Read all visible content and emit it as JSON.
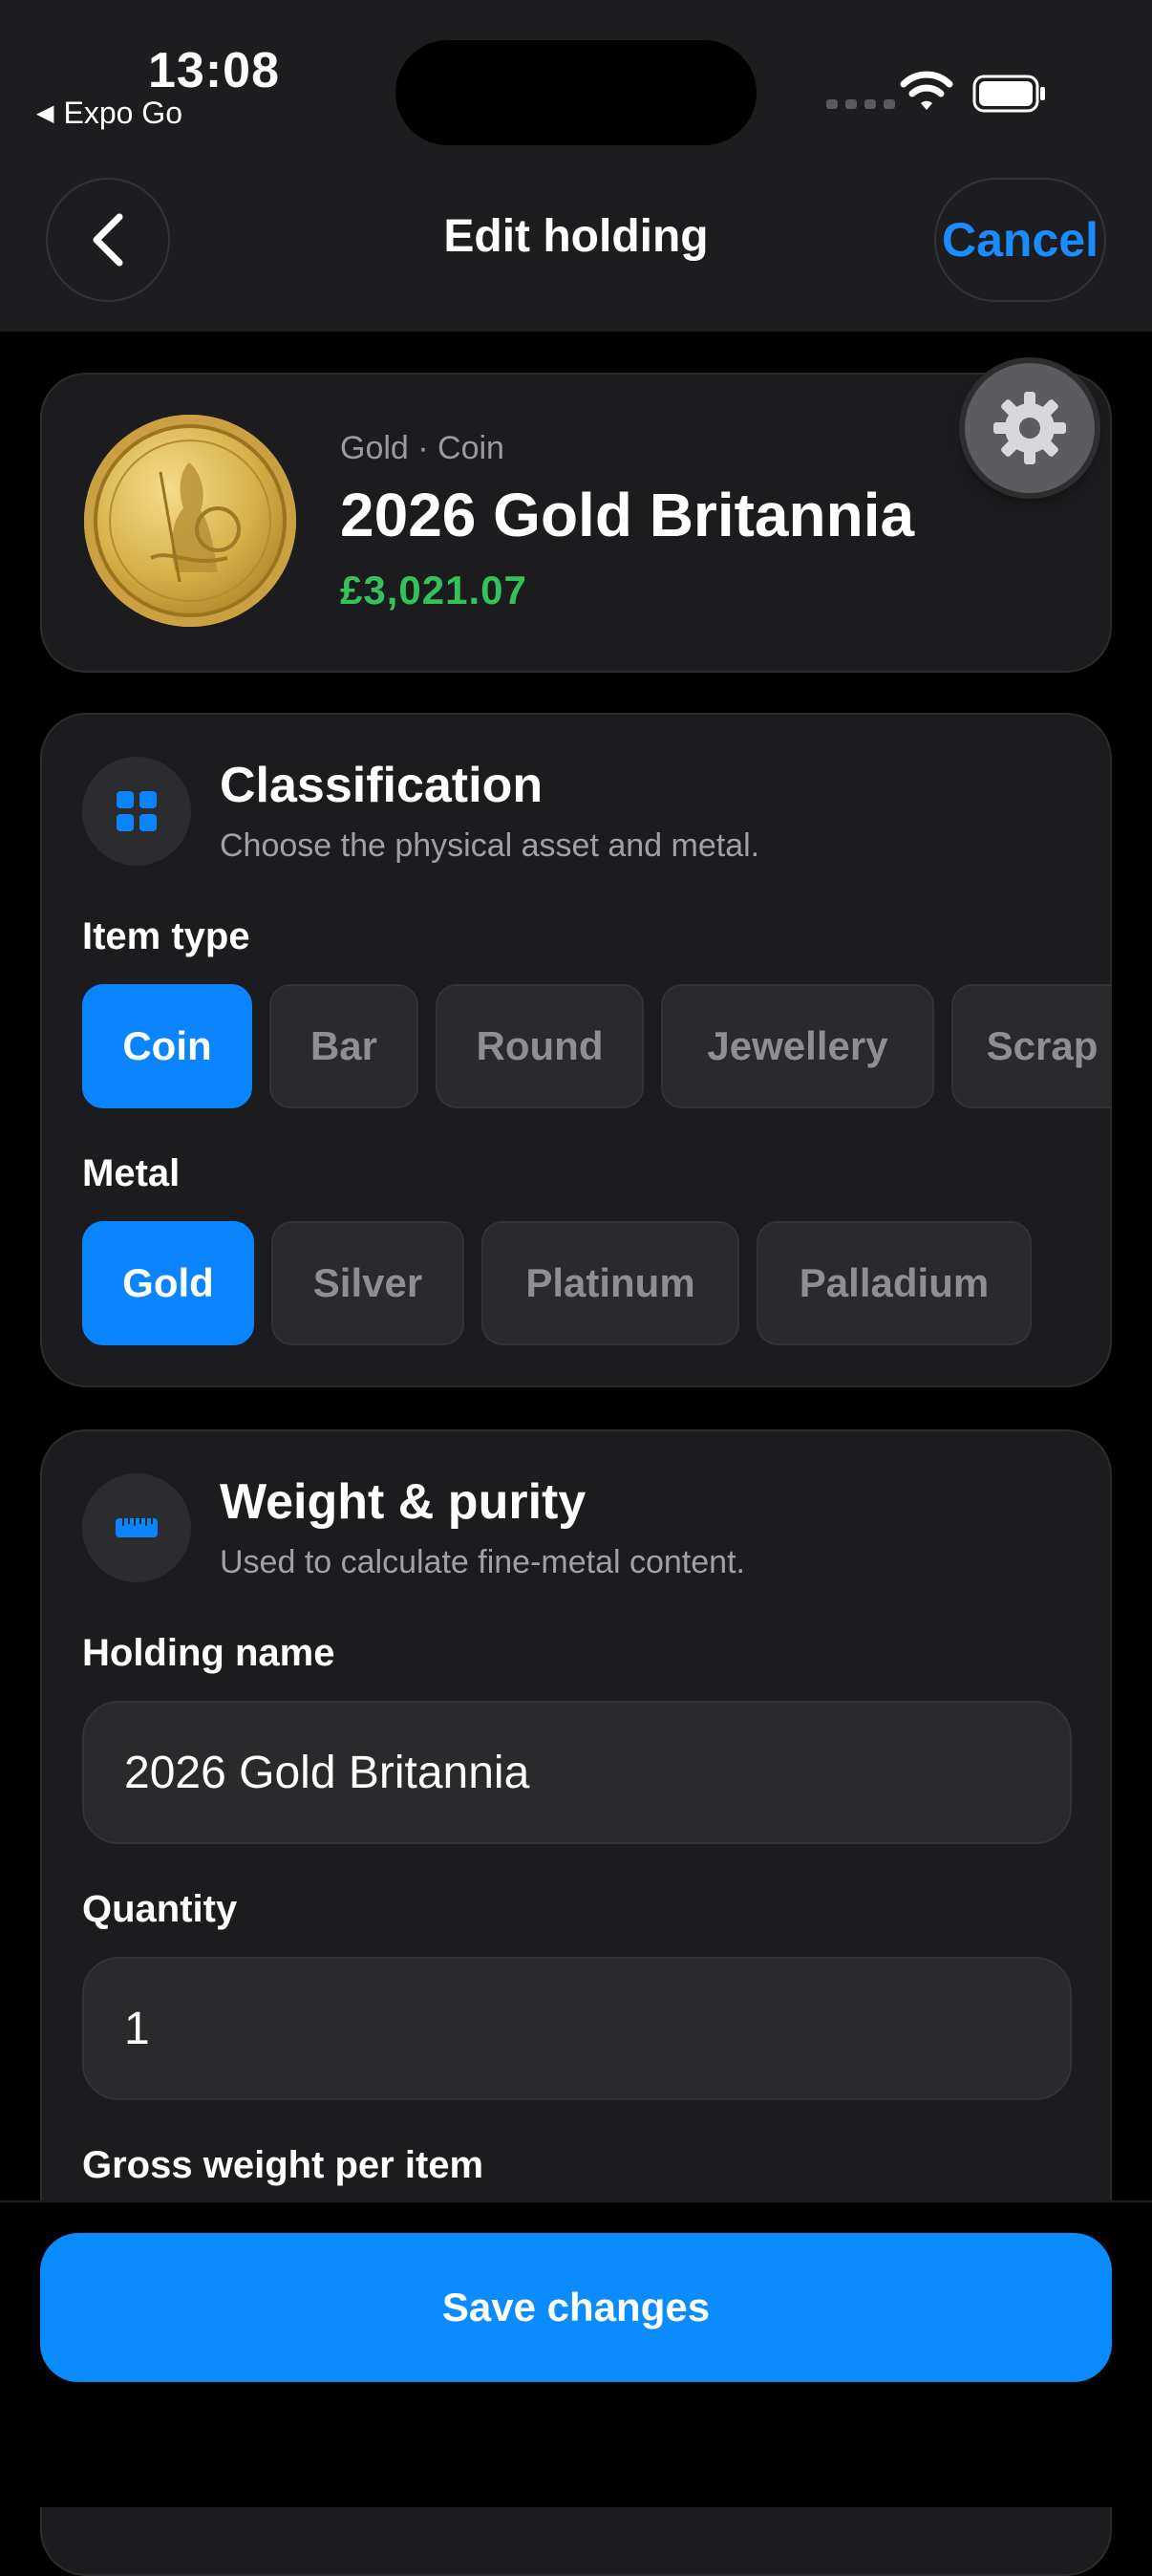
{
  "status_bar": {
    "time": "13:08",
    "back_app": "Expo Go"
  },
  "header": {
    "title": "Edit holding",
    "cancel_label": "Cancel"
  },
  "holding": {
    "subtitle": "Gold · Coin",
    "name": "2026 Gold Britannia",
    "price": "£3,021.07"
  },
  "classification": {
    "title": "Classification",
    "subtitle": "Choose the physical asset and metal.",
    "item_type_label": "Item type",
    "item_types": [
      "Coin",
      "Bar",
      "Round",
      "Jewellery",
      "Scrap"
    ],
    "selected_item_type": "Coin",
    "metal_label": "Metal",
    "metals": [
      "Gold",
      "Silver",
      "Platinum",
      "Palladium"
    ],
    "selected_metal": "Gold"
  },
  "weight_purity": {
    "title": "Weight & purity",
    "subtitle": "Used to calculate fine-metal content.",
    "holding_name_label": "Holding name",
    "holding_name_value": "2026 Gold Britannia",
    "quantity_label": "Quantity",
    "quantity_value": "1",
    "gross_weight_label": "Gross weight per item"
  },
  "footer": {
    "save_label": "Save changes"
  },
  "colors": {
    "accent": "#0a84ff",
    "price": "#32c35a",
    "card": "#1c1c1e"
  }
}
